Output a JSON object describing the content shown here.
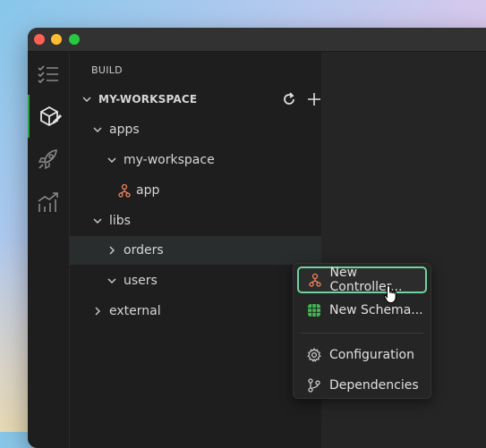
{
  "colors": {
    "accent_green": "#2ea043",
    "focus_border": "#6fd3a0",
    "controller_icon": "#f0825c",
    "schematic_icon": "#3fb950"
  },
  "activity_bar": {
    "items": [
      {
        "name": "tasks-icon",
        "active": false
      },
      {
        "name": "build-icon",
        "active": true
      },
      {
        "name": "rocket-icon",
        "active": false
      },
      {
        "name": "chart-icon",
        "active": false
      }
    ]
  },
  "sidebar": {
    "section_title": "BUILD",
    "workspace": {
      "label": "MY-WORKSPACE"
    },
    "tree": [
      {
        "label": "apps"
      },
      {
        "label": "my-workspace"
      },
      {
        "label": "app"
      },
      {
        "label": "libs"
      },
      {
        "label": "orders"
      },
      {
        "label": "users"
      },
      {
        "label": "external"
      }
    ]
  },
  "context_menu": {
    "items": [
      {
        "label": "New Controller...",
        "icon": "controller-icon"
      },
      {
        "label": "New Schema...",
        "icon": "schematic-icon"
      },
      {
        "label": "Configuration",
        "icon": "gear-icon"
      },
      {
        "label": "Dependencies",
        "icon": "dependencies-icon"
      }
    ]
  }
}
